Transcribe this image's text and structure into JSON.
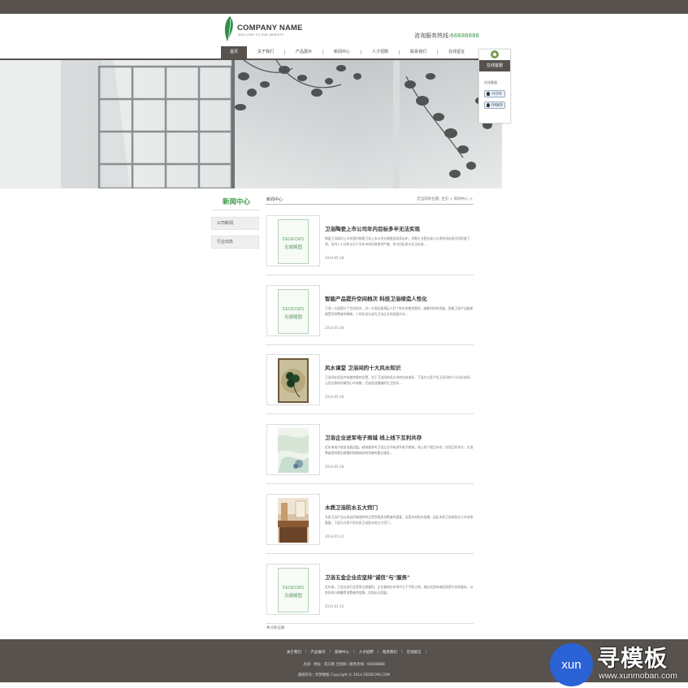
{
  "header": {
    "company_name": "COMPANY NAME",
    "tagline": "WELCOME TO OUR WEBSITE",
    "hotline_label": "咨询服务热线:",
    "hotline_number": "66688888"
  },
  "nav": {
    "items": [
      "首页",
      "关于我们",
      "产品展示",
      "新闻中心",
      "人才招聘",
      "联系我们",
      "在线留言"
    ],
    "active_index": 0
  },
  "service": {
    "title": "在线客服",
    "label": "在线客服",
    "buttons": [
      "QQ交谈",
      "在线留言"
    ]
  },
  "sidebar": {
    "title": "新闻中心",
    "items": [
      "公司新闻",
      "行业动态"
    ]
  },
  "breadcrumb": {
    "title": "新闻中心",
    "path": "您当前的位置: 主页 > 新闻中心 >"
  },
  "news": [
    {
      "title": "卫浴陶瓷上市公司年内目标多半无法实现",
      "summary": "陶瓷卫浴网讯上半年国内陶瓷卫浴上市公司业绩报告陆续出炉，多数企业营业收入与净利润出现不同程度下滑，业内人士分析认为下半年市场形势依然严峻，年内目标多半无法实现...",
      "date": "2014-05-28",
      "thumb": "placeholder"
    },
    {
      "title": "智能产品提升空间档次 科技卫浴缔造人性化",
      "summary": "卫浴一方面提升了空间档次，另一方面还能满足人们个性化的使用需求，随着科技的发展，智能卫浴产品越来越受到消费者的青睐，人性化设计成为卫浴企业的发展方向...",
      "date": "2014-05-28",
      "thumb": "placeholder"
    },
    {
      "title": "风水课堂 卫浴间的十大风水知识",
      "summary": "卫浴间在家居中有着特殊的位置，关于卫浴间的风水讲究也有很多，下面为大家介绍卫浴间的十大风水知识，让您在装修时做到心中有数，打造舒适健康的生活空间...",
      "date": "2014-05-28",
      "thumb": "clover"
    },
    {
      "title": "卫浴企业进军电子商城 线上线下互利共存",
      "summary": "近年来电子商务发展迅猛，越来越多的卫浴企业开始进军电子商城，线上线下相互补充，实现互利共存，为消费者提供更加便捷的购物体验和完善的售后服务...",
      "date": "2014-05-28",
      "thumb": "watercolor"
    },
    {
      "title": "木质卫浴防水五大窍门",
      "summary": "木质卫浴产品以其自然美观的特点受到很多消费者的喜爱，但是木材怕水怕潮，因此木质卫浴的防水工作非常重要，下面为大家介绍木质卫浴防水的五大窍门...",
      "date": "2014-01-12",
      "thumb": "bathroom"
    },
    {
      "title": "卫浴五金企业应坚持\"诚信\"与\"服务\"",
      "summary": "近年来，卫浴五金行业竞争日趋激烈，企业要想在市场中立于不败之地，就必须坚持诚信经营与优质服务，以良好的口碑赢得消费者的信赖，实现长远发展...",
      "date": "2014-01-12",
      "thumb": "placeholder"
    }
  ],
  "placeholder": {
    "line1": "DEDECMS",
    "line2": "无缩略图"
  },
  "pagination": {
    "text": "共 6条记录"
  },
  "footer": {
    "links": [
      "关于我们",
      "产品展示",
      "新闻中心",
      "人才招聘",
      "联系我们",
      "在线留言"
    ],
    "address": "总部：地址：南方路  全国统一服务热线：66688888",
    "copyright": "版权所有：织梦模板 Copyright © 2014 DEDECMS.COM"
  },
  "watermark": {
    "circle": "xun",
    "cn": "寻模板",
    "url": "www.xunmoban.com"
  },
  "colors": {
    "brand_dark": "#57524d",
    "accent_green": "#3f9a4c"
  }
}
